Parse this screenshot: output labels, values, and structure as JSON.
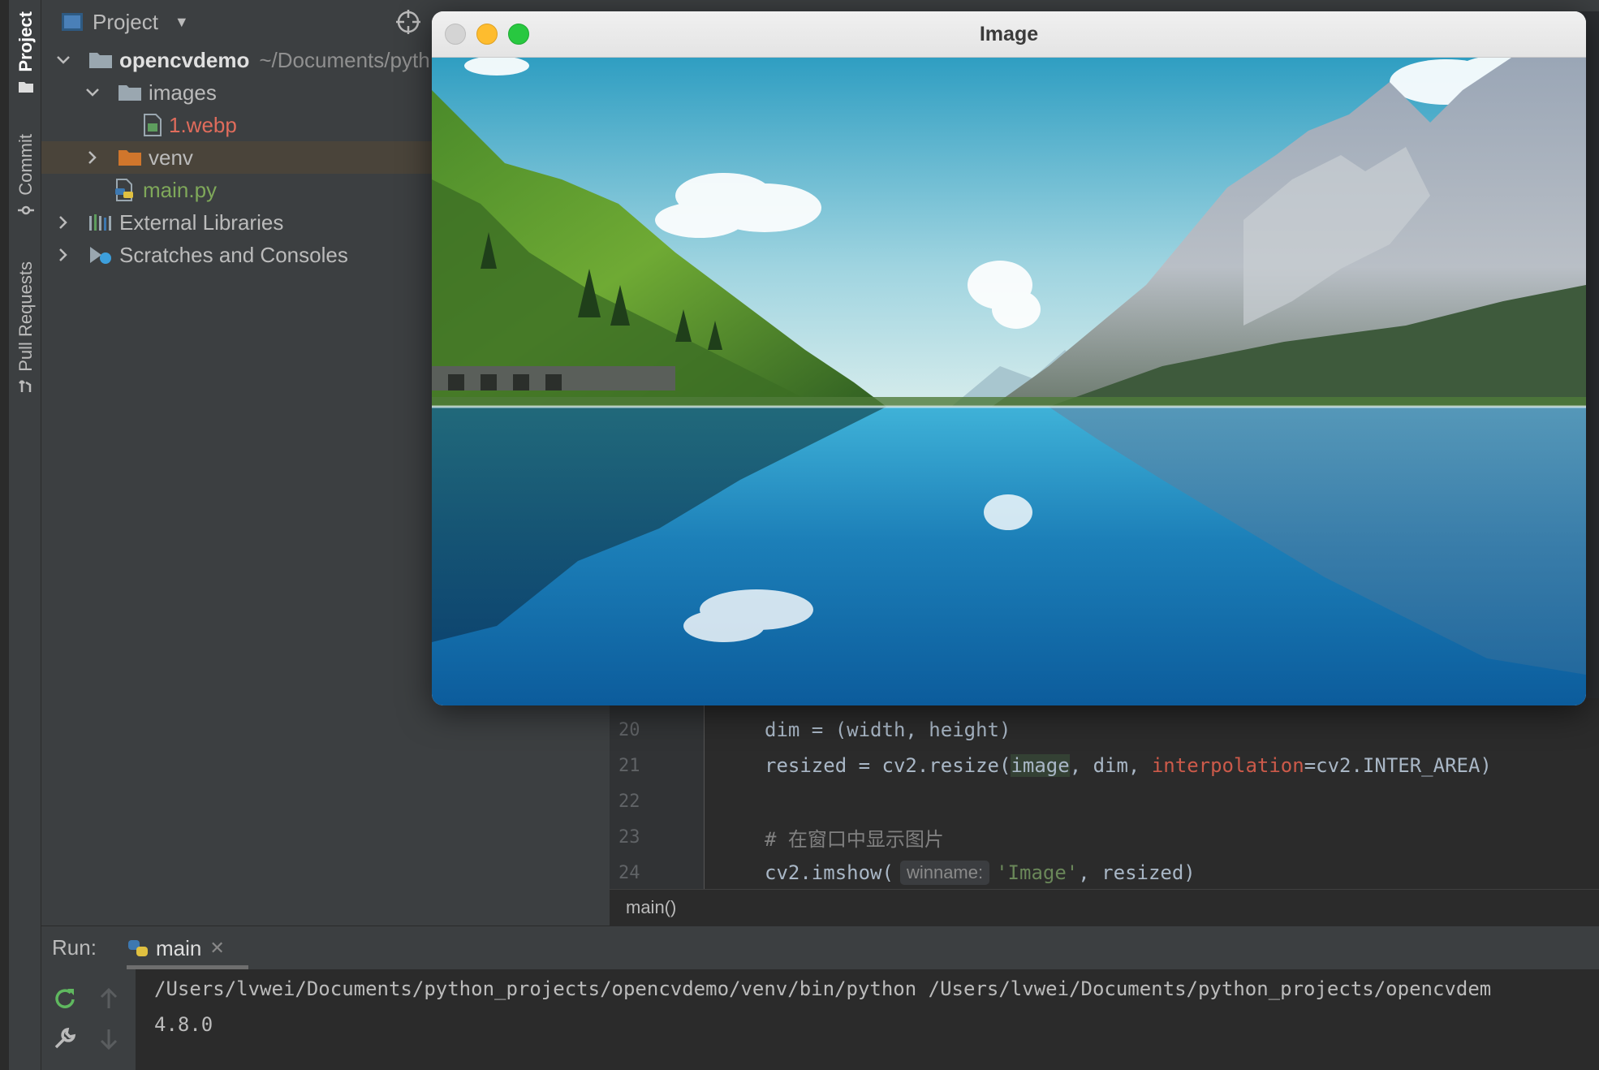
{
  "tool_strip": {
    "project_label": "Project",
    "commit_label": "Commit",
    "pull_requests_label": "Pull Requests"
  },
  "project_panel": {
    "title": "Project",
    "tree": [
      {
        "label": "opencvdemo",
        "path": "~/Documents/pyth",
        "icon": "folder-icon",
        "expanded": true
      },
      {
        "label": "images",
        "icon": "folder-icon",
        "expanded": true
      },
      {
        "label": "1.webp",
        "icon": "image-file-icon"
      },
      {
        "label": "venv",
        "icon": "orange-folder-icon",
        "expanded": false
      },
      {
        "label": "main.py",
        "icon": "python-file-icon"
      },
      {
        "label": "External Libraries",
        "icon": "library-icon",
        "expanded": false
      },
      {
        "label": "Scratches and Consoles",
        "icon": "scratches-icon",
        "expanded": false
      }
    ]
  },
  "editor": {
    "lines": [
      {
        "num": "20",
        "text": "dim = (width, height)"
      },
      {
        "num": "21",
        "pre": "resized = cv2.resize(",
        "hl": "image",
        "mid": ", dim, ",
        "param": "interpolation",
        "post": "=cv2.INTER_AREA)"
      },
      {
        "num": "22",
        "text": ""
      },
      {
        "num": "23",
        "comment": "# 在窗口中显示图片"
      },
      {
        "num": "24",
        "pre": "cv2.imshow(",
        "hint": "winname:",
        "str": "'Image'",
        "post": ", resized)"
      }
    ],
    "breadcrumb": "main()"
  },
  "run_panel": {
    "label": "Run:",
    "tab_label": "main",
    "output": [
      "/Users/lvwei/Documents/python_projects/opencvdemo/venv/bin/python /Users/lvwei/Documents/python_projects/opencvdem",
      "4.8.0"
    ]
  },
  "image_window": {
    "title": "Image"
  },
  "colors": {
    "ide_bg": "#3c3f41",
    "editor_bg": "#2b2b2b",
    "traffic_close": "#d8d8d8",
    "traffic_min": "#febc2e",
    "traffic_max": "#28c840"
  }
}
